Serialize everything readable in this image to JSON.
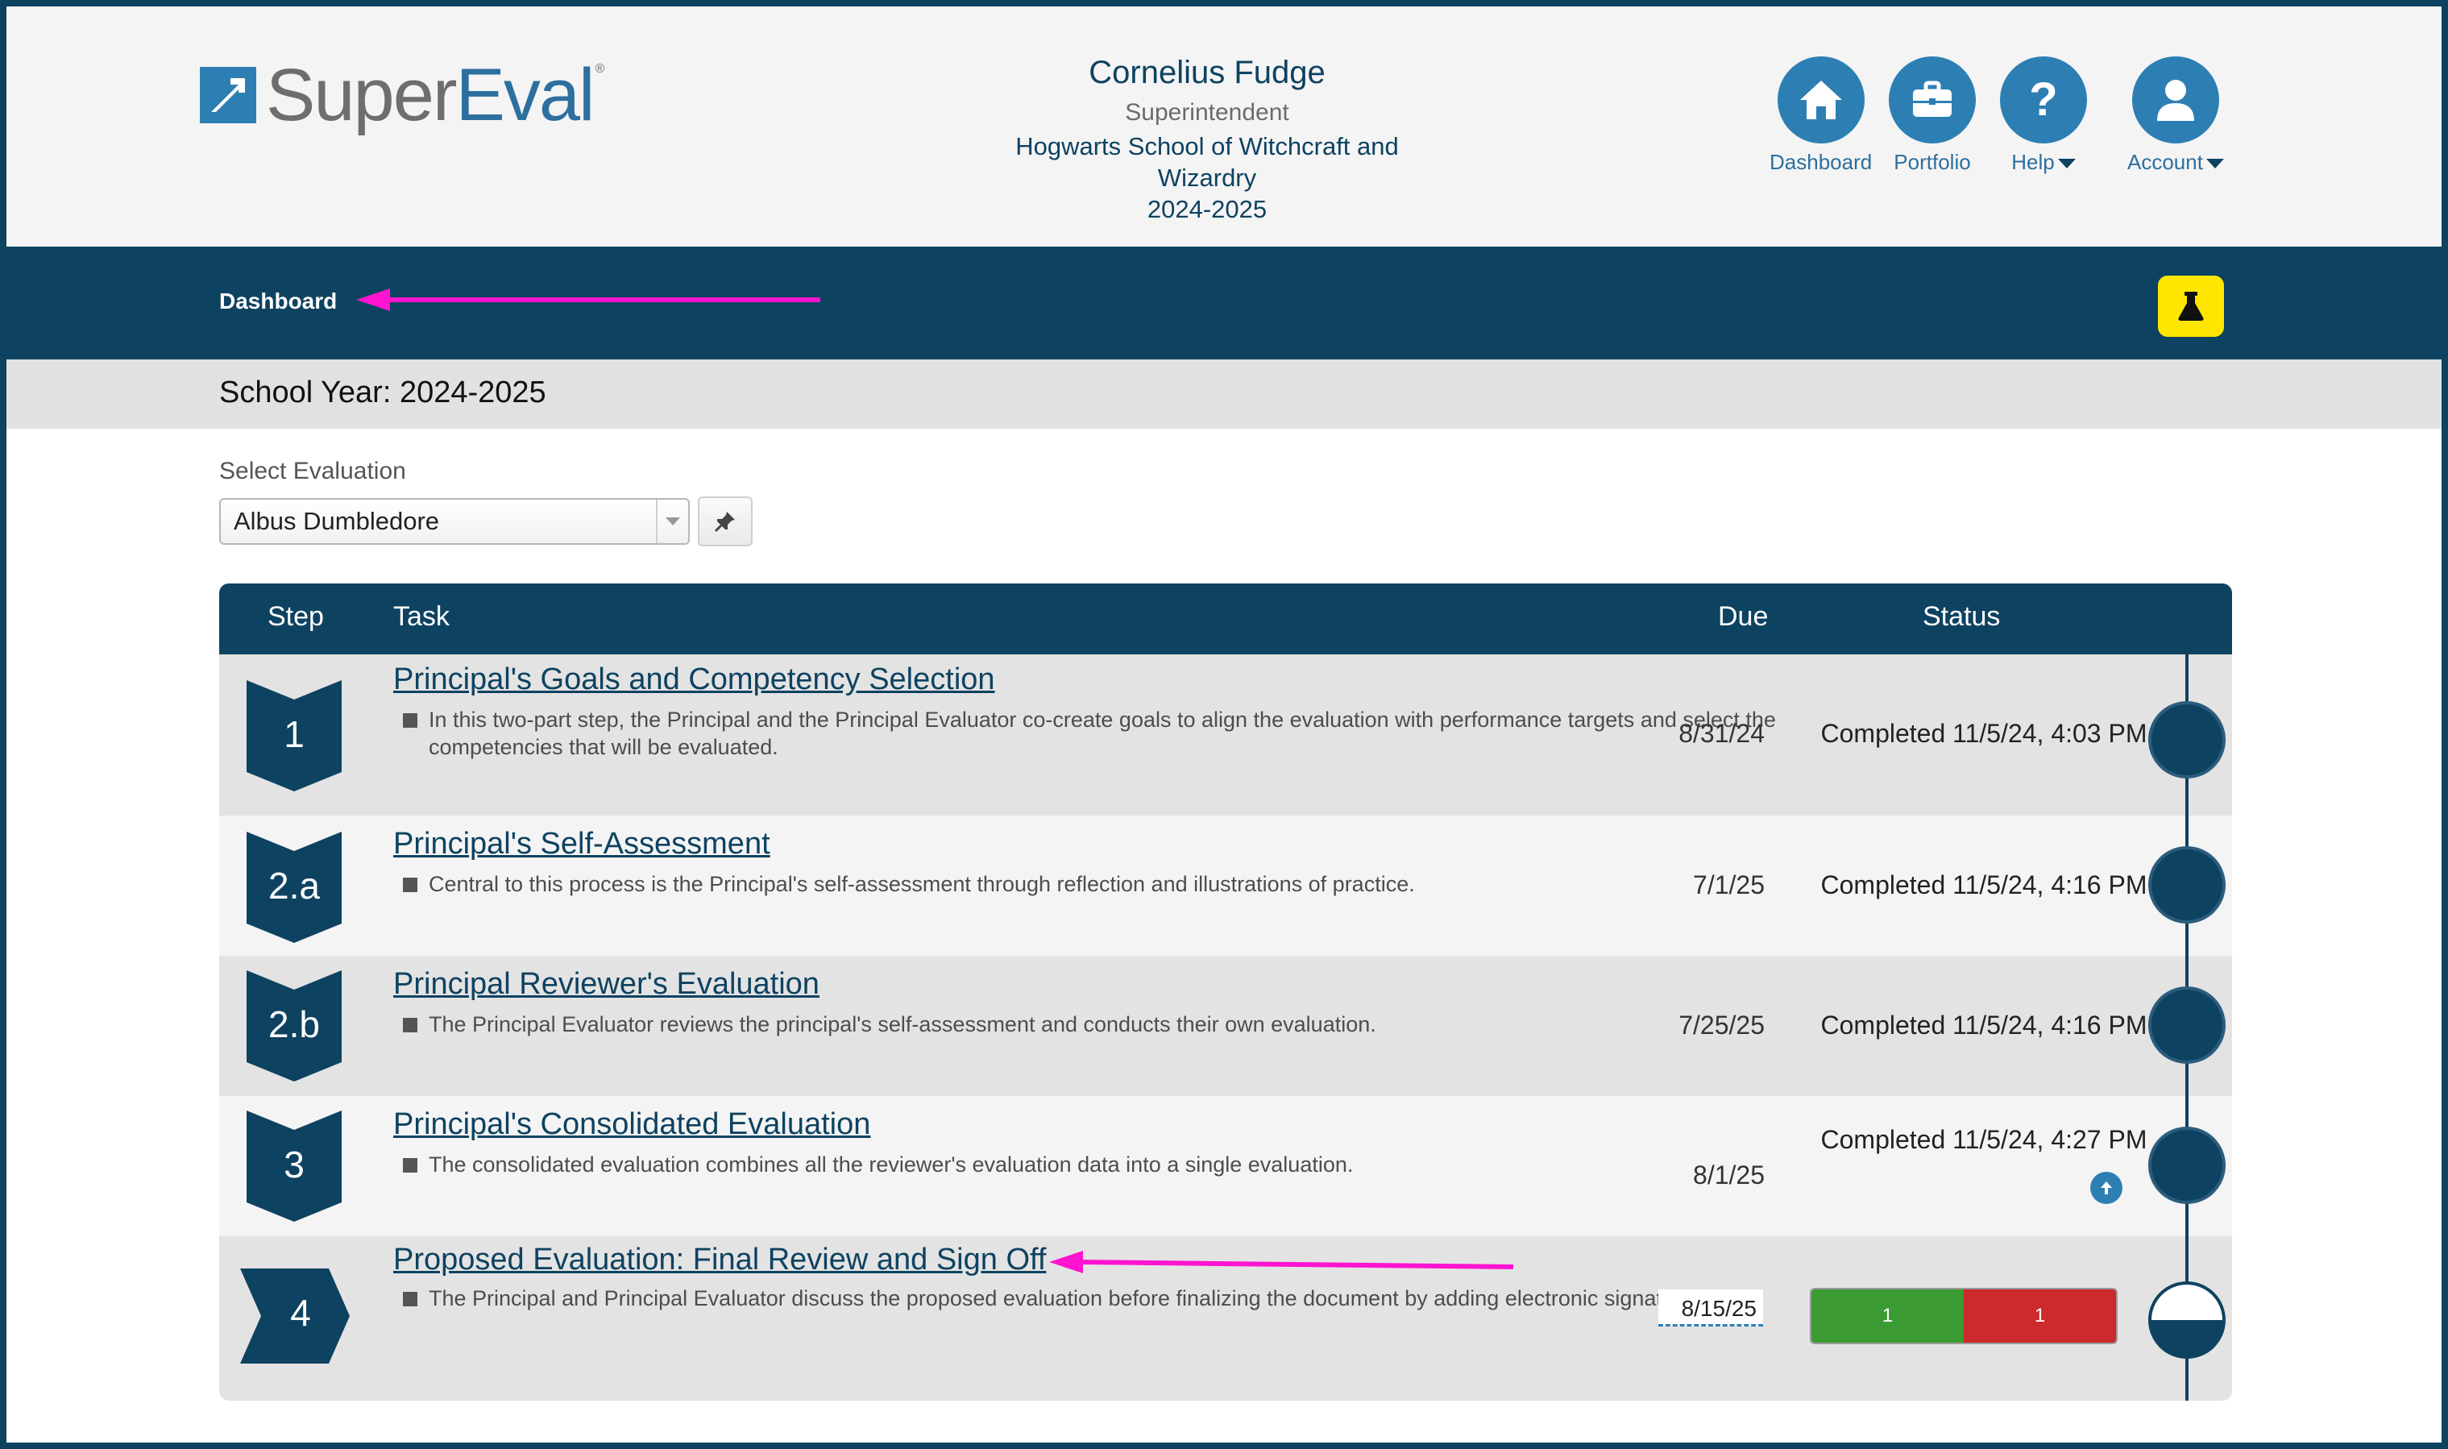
{
  "brand": {
    "name_part1": "Super",
    "name_part2": "Eval",
    "registered": "®"
  },
  "user": {
    "name": "Cornelius Fudge",
    "role": "Superintendent",
    "school": "Hogwarts School of Witchcraft and Wizardry",
    "year": "2024-2025"
  },
  "top_nav": [
    {
      "label": "Dashboard",
      "icon": "home-icon"
    },
    {
      "label": "Portfolio",
      "icon": "briefcase-icon"
    },
    {
      "label": "Help",
      "icon": "question-icon",
      "dropdown": true
    },
    {
      "label": "Account",
      "icon": "user-icon",
      "dropdown": true
    }
  ],
  "breadcrumb": "Dashboard",
  "lab_button": {
    "icon": "flask-icon",
    "color": "#ffe600"
  },
  "school_year": "School Year: 2024-2025",
  "select_evaluation": {
    "label": "Select Evaluation",
    "value": "Albus Dumbledore",
    "pin_icon": "pin-icon"
  },
  "table": {
    "headers": {
      "step": "Step",
      "task": "Task",
      "due": "Due",
      "status": "Status"
    },
    "rows": [
      {
        "step": "1",
        "title": "Principal's Goals and Competency Selection",
        "description": "In this two-part step, the Principal and the Principal Evaluator co-create goals to align the evaluation with performance targets and select the competencies that will be evaluated.",
        "due": "8/31/24",
        "status": "Completed 11/5/24, 4:03 PM"
      },
      {
        "step": "2.a",
        "title": "Principal's Self-Assessment",
        "description": "Central to this process is the Principal's self-assessment through reflection and illustrations of practice.",
        "due": "7/1/25",
        "status": "Completed 11/5/24, 4:16 PM"
      },
      {
        "step": "2.b",
        "title": "Principal Reviewer's Evaluation",
        "description": "The Principal Evaluator reviews the principal's self-assessment and conducts their own evaluation.",
        "due": "7/25/25",
        "status": "Completed 11/5/24, 4:16 PM"
      },
      {
        "step": "3",
        "title": "Principal's Consolidated Evaluation",
        "description": "The consolidated evaluation combines all the reviewer's evaluation data into a single evaluation.",
        "due": "8/1/25",
        "status": "Completed 11/5/24, 4:27 PM"
      },
      {
        "step": "4",
        "title": "Proposed Evaluation: Final Review and Sign Off",
        "description": "The Principal and Principal Evaluator discuss the proposed evaluation before finalizing the document by adding electronic signatures.",
        "due": "8/15/25",
        "progress": {
          "complete": "1",
          "pending": "1",
          "complete_color": "#3c9a33",
          "pending_color": "#cc2a2d"
        },
        "node_fill_fraction": 0.5
      }
    ]
  },
  "colors": {
    "primary": "#0e4261",
    "accent": "#2d7fb3",
    "annotation": "#ff14d0"
  }
}
